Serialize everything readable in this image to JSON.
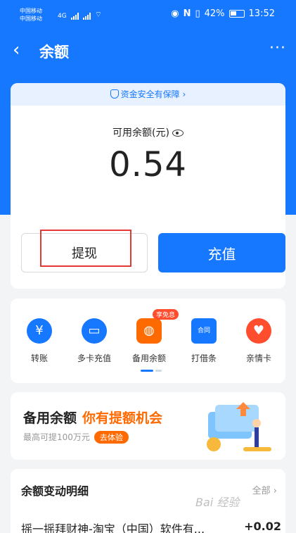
{
  "status_bar": {
    "carrier1": "中国移动",
    "carrier2": "中国移动",
    "network": "4G",
    "battery": "42%",
    "time": "13:52"
  },
  "header": {
    "title": "余额",
    "back_icon": "chevron-left-icon",
    "more": "···"
  },
  "balance": {
    "safety_text": "资金安全有保障",
    "label": "可用余额(元)",
    "amount": "0.54"
  },
  "actions": {
    "withdraw": "提现",
    "recharge": "充值"
  },
  "services": {
    "items": [
      {
        "label": "转账",
        "icon": "yuan-transfer-icon"
      },
      {
        "label": "多卡充值",
        "icon": "card-recharge-icon"
      },
      {
        "label": "备用余额",
        "icon": "wallet-icon",
        "badge": "享免息"
      },
      {
        "label": "打借条",
        "icon": "iou-contract-icon",
        "icon_text": "合同"
      },
      {
        "label": "亲情卡",
        "icon": "family-heart-icon"
      }
    ]
  },
  "promo": {
    "title": "备用余额",
    "highlight": "你有提额机会",
    "sub": "最高可提100万元",
    "button": "去体验"
  },
  "details": {
    "title": "余额变动明细",
    "all": "全部",
    "transaction": {
      "desc": "摇一摇拜财神-淘宝（中国）软件有...",
      "amount": "+0.02"
    }
  },
  "watermark": "Bai 经验",
  "colors": {
    "primary": "#1677ff",
    "accent": "#ff6a00",
    "badge": "#ff4d2e",
    "highlight_box": "#e53935"
  }
}
